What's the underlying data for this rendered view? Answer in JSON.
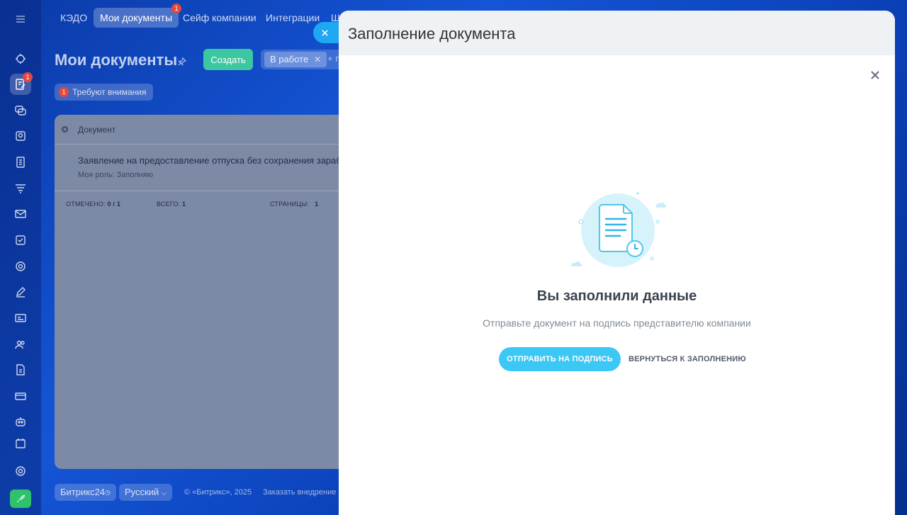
{
  "topnav": {
    "items": [
      {
        "label": "КЭДО",
        "active": false
      },
      {
        "label": "Мои документы",
        "active": true,
        "badge": "1"
      },
      {
        "label": "Сейф компании",
        "active": false
      },
      {
        "label": "Интеграции",
        "active": false
      },
      {
        "label": "Ш",
        "active": false
      }
    ]
  },
  "rail": {
    "active_badge": "1",
    "icons": [
      "bot-icon",
      "edit-doc-icon",
      "chat-icon",
      "drive-icon",
      "document-icon",
      "funnel-icon",
      "mail-icon",
      "checklist-icon",
      "target-icon",
      "pen-icon",
      "card-icon",
      "team-icon",
      "file-icon",
      "payment-icon",
      "robot-icon",
      "calendar-icon"
    ],
    "settings_icon": "gear-icon",
    "bottom_icon": "rocket-icon"
  },
  "page": {
    "title": "Мои документы",
    "create_label": "Создать",
    "filter_chip": "В работе",
    "filter_plus": "+ п",
    "attention_count": "1",
    "attention_label": "Требуют внимания"
  },
  "grid": {
    "column_document": "Документ",
    "row": {
      "title": "Заявление на предоставление отпуска без сохранения зарабо",
      "role": "Моя роль: Заполняю"
    },
    "footer": {
      "marked_label": "ОТМЕЧЕНО:",
      "marked_value": "0 / 1",
      "total_label": "ВСЕГО:",
      "total_value": "1",
      "pages_label": "СТРАНИЦЫ:",
      "pages_value": "1"
    }
  },
  "bottom": {
    "brand": "Битрикс24",
    "language": "Русский",
    "copyright": "© «Битрикс», 2025",
    "order_link": "Заказать внедрение"
  },
  "panel": {
    "title": "Заполнение документа",
    "result_title": "Вы заполнили данные",
    "result_subtitle": "Отправьте документ на подпись представителю компании",
    "send_button": "ОТПРАВИТЬ НА ПОДПИСЬ",
    "back_button": "ВЕРНУТЬСЯ К ЗАПОЛНЕНИЮ"
  },
  "colors": {
    "accent": "#3bc8f5",
    "create": "#3bc8a0",
    "badge": "#e5473f",
    "slider_close": "#1ea7f2"
  }
}
